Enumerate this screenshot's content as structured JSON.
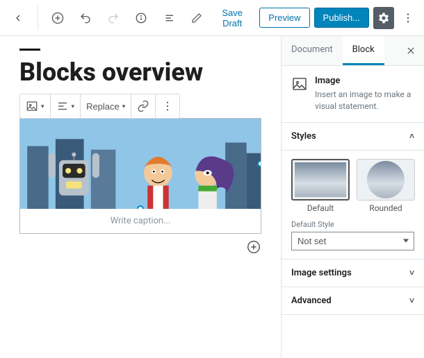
{
  "topbar": {
    "save_draft": "Save Draft",
    "preview": "Preview",
    "publish": "Publish..."
  },
  "post": {
    "title": "Blocks overview",
    "caption_placeholder": "Write caption..."
  },
  "block_toolbar": {
    "replace": "Replace"
  },
  "sidebar": {
    "tabs": {
      "document": "Document",
      "block": "Block"
    },
    "block_card": {
      "title": "Image",
      "description": "Insert an image to make a visual statement."
    },
    "panels": {
      "styles": {
        "title": "Styles",
        "options": [
          {
            "label": "Default",
            "selected": true
          },
          {
            "label": "Rounded",
            "selected": false
          }
        ],
        "default_style_label": "Default Style",
        "default_style_value": "Not set"
      },
      "image_settings": {
        "title": "Image settings"
      },
      "advanced": {
        "title": "Advanced"
      }
    }
  }
}
